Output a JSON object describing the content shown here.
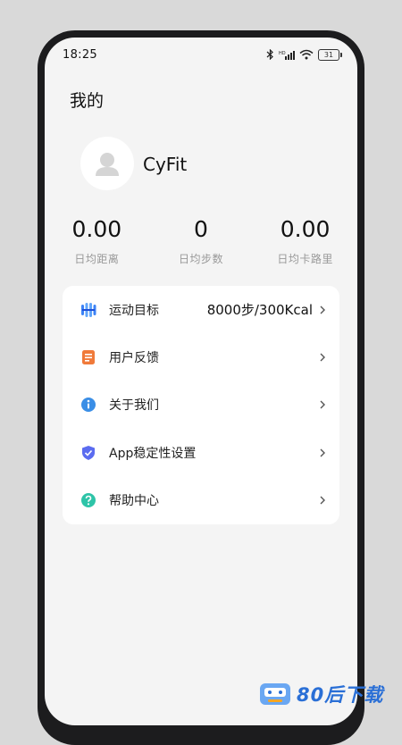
{
  "status_bar": {
    "time": "18:25",
    "battery": "31"
  },
  "page": {
    "title": "我的"
  },
  "profile": {
    "username": "CyFit"
  },
  "stats": [
    {
      "value": "0.00",
      "label": "日均距离"
    },
    {
      "value": "0",
      "label": "日均步数"
    },
    {
      "value": "0.00",
      "label": "日均卡路里"
    }
  ],
  "menu": [
    {
      "label": "运动目标",
      "value": "8000步/300Kcal",
      "icon": "target-icon",
      "color": "#3b82f6"
    },
    {
      "label": "用户反馈",
      "value": "",
      "icon": "feedback-icon",
      "color": "#f07a3a"
    },
    {
      "label": "关于我们",
      "value": "",
      "icon": "info-icon",
      "color": "#3a8ee6"
    },
    {
      "label": "App稳定性设置",
      "value": "",
      "icon": "shield-icon",
      "color": "#5b6cf0"
    },
    {
      "label": "帮助中心",
      "value": "",
      "icon": "help-icon",
      "color": "#2ec4a8"
    }
  ],
  "watermark": {
    "text": "80后下载"
  }
}
